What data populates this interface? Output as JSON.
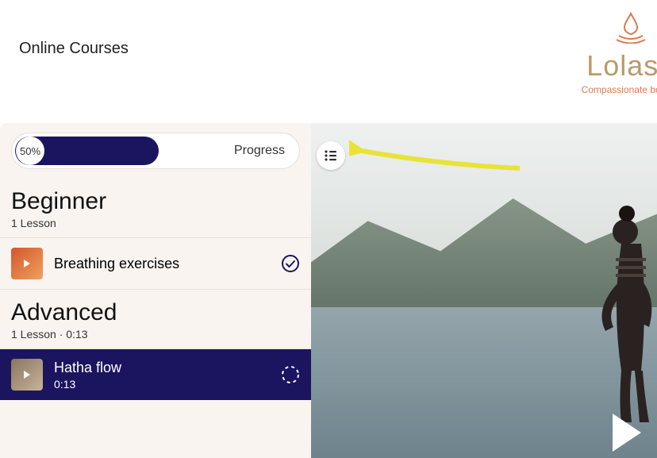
{
  "header": {
    "breadcrumb": "Online Courses",
    "brand_name": "Lolasa",
    "brand_tagline": "Compassionate bodies,"
  },
  "progress": {
    "percent_label": "50%",
    "percent_value": 50,
    "label": "Progress"
  },
  "sections": [
    {
      "title": "Beginner",
      "subtitle": "1 Lesson",
      "lessons": [
        {
          "title": "Breathing exercises",
          "duration": "",
          "completed": true,
          "active": false
        }
      ]
    },
    {
      "title": "Advanced",
      "subtitle": "1 Lesson · 0:13",
      "lessons": [
        {
          "title": "Hatha flow",
          "duration": "0:13",
          "completed": false,
          "active": true
        }
      ]
    }
  ],
  "colors": {
    "accent": "#1B1560",
    "sidebar_bg": "#F9F4F0",
    "brand_text": "#B99A6B",
    "brand_accent": "#D97B4E",
    "arrow": "#E8E337"
  }
}
